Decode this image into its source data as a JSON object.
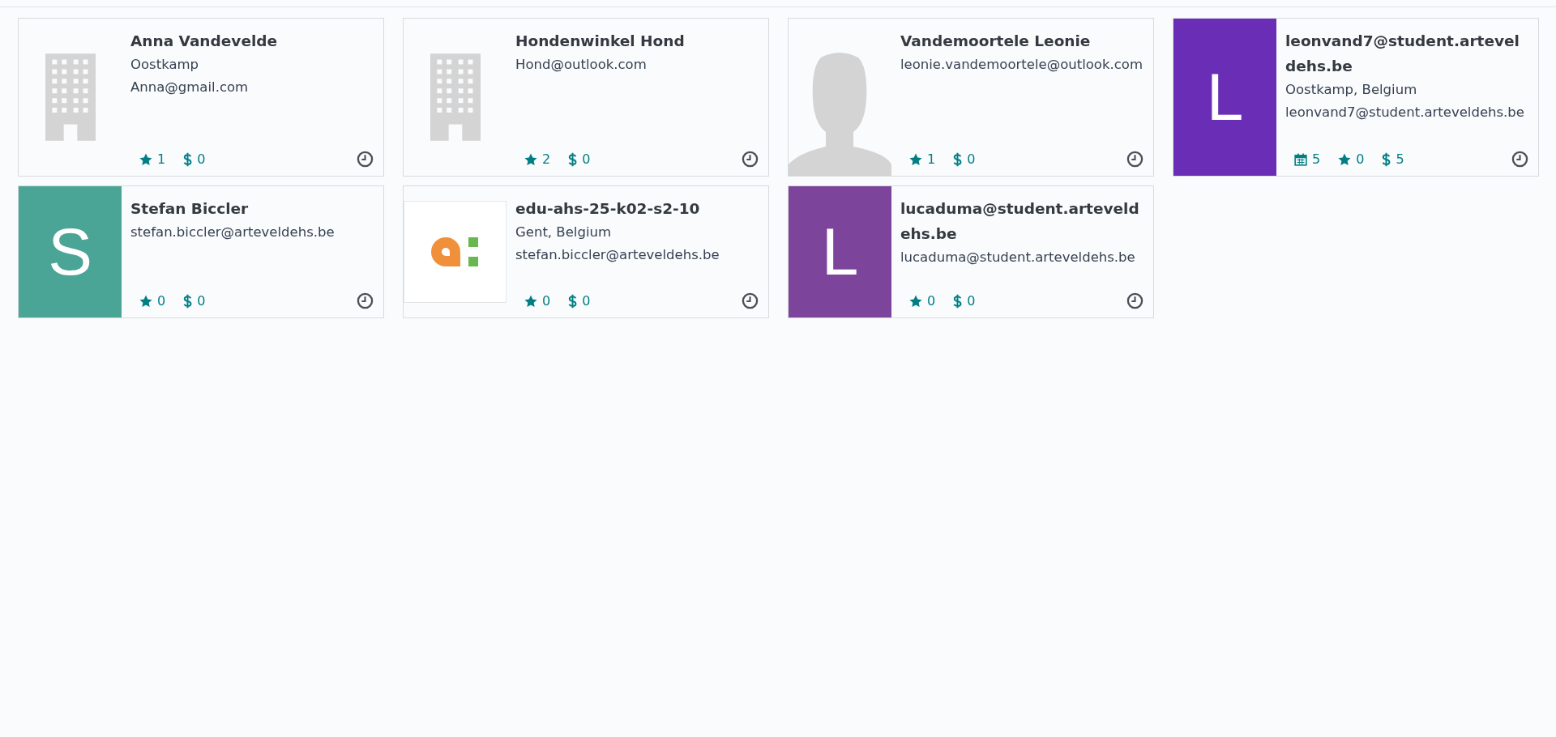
{
  "cards": [
    {
      "name": "Anna Vandevelde",
      "avatar": {
        "kind": "building"
      },
      "lines": [
        "Oostkamp",
        "Anna@gmail.com"
      ],
      "stats": [
        {
          "kind": "opportunities",
          "value": "1"
        },
        {
          "kind": "sales",
          "value": "0"
        }
      ]
    },
    {
      "name": "Hondenwinkel Hond",
      "avatar": {
        "kind": "building"
      },
      "lines": [
        "Hond@outlook.com"
      ],
      "stats": [
        {
          "kind": "opportunities",
          "value": "2"
        },
        {
          "kind": "sales",
          "value": "0"
        }
      ]
    },
    {
      "name": "Vandemoortele Leonie",
      "avatar": {
        "kind": "person"
      },
      "lines": [
        "leonie.vandemoortele@outlook.com"
      ],
      "stats": [
        {
          "kind": "opportunities",
          "value": "1"
        },
        {
          "kind": "sales",
          "value": "0"
        }
      ]
    },
    {
      "name": "leonvand7@student.arteveldehs.be",
      "avatar": {
        "kind": "letter",
        "letter": "L",
        "color": "#6a2db5"
      },
      "lines": [
        "Oostkamp, Belgium",
        "leonvand7@student.arteveldehs.be"
      ],
      "stats": [
        {
          "kind": "meetings",
          "value": "5"
        },
        {
          "kind": "opportunities",
          "value": "0"
        },
        {
          "kind": "sales",
          "value": "5"
        }
      ]
    },
    {
      "name": "Stefan Biccler",
      "avatar": {
        "kind": "letter",
        "letter": "S",
        "color": "#4aa596"
      },
      "lines": [
        "stefan.biccler@arteveldehs.be"
      ],
      "stats": [
        {
          "kind": "opportunities",
          "value": "0"
        },
        {
          "kind": "sales",
          "value": "0"
        }
      ]
    },
    {
      "name": "edu-ahs-25-k02-s2-10",
      "avatar": {
        "kind": "logo"
      },
      "lines": [
        "Gent, Belgium",
        "stefan.biccler@arteveldehs.be"
      ],
      "stats": [
        {
          "kind": "opportunities",
          "value": "0"
        },
        {
          "kind": "sales",
          "value": "0"
        }
      ]
    },
    {
      "name": "lucaduma@student.arteveldehs.be",
      "avatar": {
        "kind": "letter",
        "letter": "L",
        "color": "#7d449c"
      },
      "lines": [
        "lucaduma@student.arteveldehs.be"
      ],
      "stats": [
        {
          "kind": "opportunities",
          "value": "0"
        },
        {
          "kind": "sales",
          "value": "0"
        }
      ]
    }
  ]
}
